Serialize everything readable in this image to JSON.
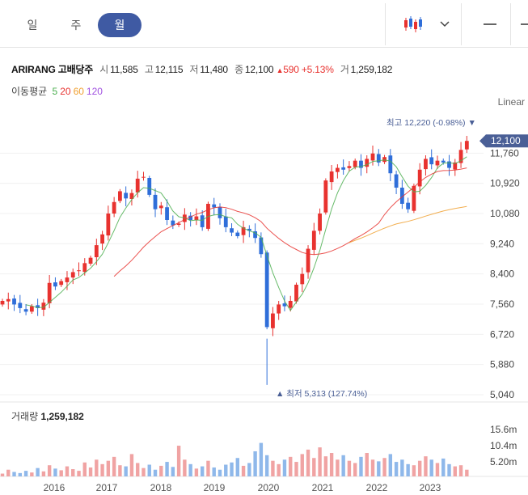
{
  "tabs": [
    {
      "label": "일",
      "active": false
    },
    {
      "label": "주",
      "active": false
    },
    {
      "label": "월",
      "active": true
    }
  ],
  "controls": {
    "chart_type_icon": "candlestick-icon",
    "dropdown_icon": "chevron-down-icon",
    "minus_icon": "minus-icon"
  },
  "stock": {
    "name": "ARIRANG 고배당주",
    "open_label": "시",
    "open": "11,585",
    "high_label": "고",
    "high": "12,115",
    "low_label": "저",
    "low": "11,480",
    "close_label": "종",
    "close": "12,100",
    "change": "590",
    "change_pct": "+5.13%",
    "volume_label": "거",
    "volume": "1,259,182"
  },
  "ma_legend": {
    "label": "이동평균",
    "periods": [
      {
        "p": "5",
        "color": "#4caf50"
      },
      {
        "p": "20",
        "color": "#e8322f"
      },
      {
        "p": "60",
        "color": "#f0a030"
      },
      {
        "p": "120",
        "color": "#a050e0"
      }
    ]
  },
  "scale_label": "Linear",
  "colors": {
    "up": "#e8322f",
    "down": "#2f6ed9",
    "price_tag": "#4a5f96"
  },
  "chart_data": {
    "type": "candlestick",
    "interval": "monthly",
    "y_ticks": [
      "12,100",
      "11,760",
      "10,920",
      "10,080",
      "9,240",
      "8,400",
      "7,560",
      "6,720",
      "5,880",
      "5,040"
    ],
    "y_range": [
      5040,
      12600
    ],
    "x_ticks": [
      "2016",
      "2017",
      "2018",
      "2019",
      "2020",
      "2021",
      "2022",
      "2023"
    ],
    "current_price": "12,100",
    "max_label": "최고 12,220 (-0.98%)",
    "min_label": "최저 5,313 (127.74%)",
    "max_value": 12220,
    "min_value": 5313,
    "volume_title": "거래량",
    "volume_value": "1,259,182",
    "volume_ticks": [
      "15.6m",
      "10.4m",
      "5.20m"
    ],
    "closes": [
      7650,
      7700,
      7550,
      7450,
      7350,
      7500,
      7450,
      7600,
      8150,
      8050,
      8200,
      8300,
      8450,
      8500,
      8700,
      8850,
      9200,
      9500,
      10080,
      10400,
      10700,
      10500,
      10650,
      11050,
      11100,
      10600,
      10200,
      10300,
      9900,
      9750,
      9800,
      10050,
      9900,
      10000,
      9700,
      10350,
      10250,
      9950,
      9700,
      9550,
      9450,
      9700,
      9600,
      9400,
      8950,
      6920,
      7300,
      7550,
      7500,
      7650,
      8100,
      8400,
      9100,
      9600,
      10080,
      11000,
      11250,
      11350,
      11300,
      11400,
      11550,
      11350,
      11600,
      11750,
      11500,
      11650,
      11200,
      10800,
      10350,
      10200,
      10850,
      11300,
      11600,
      11450,
      11550,
      11500,
      11350,
      11500,
      11850,
      12100
    ]
  },
  "volume_pct": [
    5,
    12,
    8,
    6,
    10,
    7,
    15,
    9,
    20,
    14,
    11,
    18,
    13,
    10,
    25,
    16,
    30,
    22,
    28,
    35,
    20,
    18,
    40,
    24,
    15,
    21,
    12,
    19,
    26,
    17,
    55,
    30,
    22,
    14,
    18,
    28,
    16,
    12,
    21,
    25,
    33,
    19,
    24,
    45,
    60,
    38,
    28,
    22,
    30,
    35,
    26,
    40,
    48,
    33,
    52,
    36,
    42,
    30,
    38,
    28,
    24,
    35,
    42,
    30,
    27,
    33,
    40,
    26,
    30,
    22,
    20,
    28,
    36,
    30,
    24,
    32,
    22,
    18,
    20,
    12
  ]
}
